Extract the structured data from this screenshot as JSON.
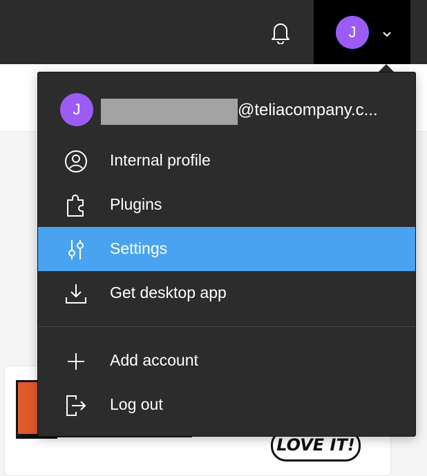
{
  "topbar": {
    "notifications_icon": "bell-icon",
    "avatar_initial": "J",
    "dropdown_icon": "chevron-down-icon"
  },
  "background": {
    "illustration_text": "LOVE IT!"
  },
  "menu": {
    "account": {
      "avatar_initial": "J",
      "email_suffix": "@teliacompany.c..."
    },
    "items": [
      {
        "label": "Internal profile",
        "icon": "user-circle-icon"
      },
      {
        "label": "Plugins",
        "icon": "puzzle-icon"
      },
      {
        "label": "Settings",
        "icon": "sliders-icon",
        "active": true
      },
      {
        "label": "Get desktop app",
        "icon": "download-icon"
      }
    ],
    "secondary_items": [
      {
        "label": "Add account",
        "icon": "plus-icon"
      },
      {
        "label": "Log out",
        "icon": "logout-icon"
      }
    ]
  },
  "colors": {
    "topbar_bg": "#2c2c2c",
    "menu_bg": "#2c2c2c",
    "active_item": "#4aa3f0",
    "avatar": "#9b5cf6",
    "redaction": "#a3a3a3"
  }
}
